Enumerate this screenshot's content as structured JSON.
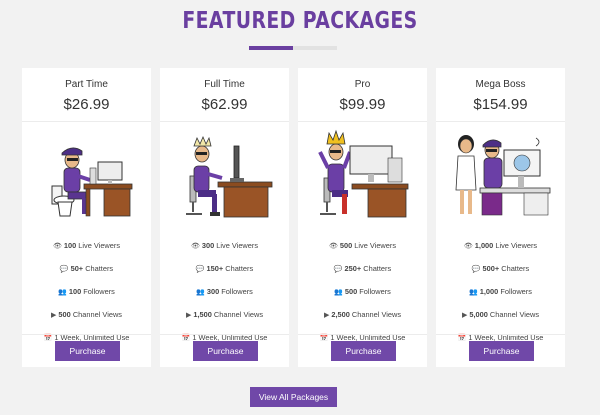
{
  "section": {
    "title": "FEATURED PACKAGES",
    "view_all_label": "View All Packages"
  },
  "colors": {
    "accent": "#6a3fa0",
    "button": "#7048a8",
    "background": "#f2f2f2",
    "card": "#ffffff"
  },
  "packages": [
    {
      "name": "Part Time",
      "price": "$26.99",
      "image": "bitmoji-on-toilet-at-desk",
      "features": [
        {
          "icon": "eye-icon",
          "glyph": "👁",
          "value": "100",
          "label": "Live Viewers"
        },
        {
          "icon": "comments-icon",
          "glyph": "💬",
          "value": "50+",
          "label": "Chatters"
        },
        {
          "icon": "users-icon",
          "glyph": "👥",
          "value": "100",
          "label": "Followers"
        },
        {
          "icon": "play-icon",
          "glyph": "▶",
          "value": "500",
          "label": "Channel Views"
        },
        {
          "icon": "calendar-icon",
          "glyph": "📅",
          "value": "",
          "label": "1 Week, Unlimited Use"
        }
      ],
      "button_label": "Purchase"
    },
    {
      "name": "Full Time",
      "price": "$62.99",
      "image": "bitmoji-with-crown-at-desk",
      "features": [
        {
          "icon": "eye-icon",
          "glyph": "👁",
          "value": "300",
          "label": "Live Viewers"
        },
        {
          "icon": "comments-icon",
          "glyph": "💬",
          "value": "150+",
          "label": "Chatters"
        },
        {
          "icon": "users-icon",
          "glyph": "👥",
          "value": "300",
          "label": "Followers"
        },
        {
          "icon": "play-icon",
          "glyph": "▶",
          "value": "1,500",
          "label": "Channel Views"
        },
        {
          "icon": "calendar-icon",
          "glyph": "📅",
          "value": "",
          "label": "1 Week, Unlimited Use"
        }
      ],
      "button_label": "Purchase"
    },
    {
      "name": "Pro",
      "price": "$99.99",
      "image": "bitmoji-king-at-desk",
      "features": [
        {
          "icon": "eye-icon",
          "glyph": "👁",
          "value": "500",
          "label": "Live Viewers"
        },
        {
          "icon": "comments-icon",
          "glyph": "💬",
          "value": "250+",
          "label": "Chatters"
        },
        {
          "icon": "users-icon",
          "glyph": "👥",
          "value": "500",
          "label": "Followers"
        },
        {
          "icon": "play-icon",
          "glyph": "▶",
          "value": "2,500",
          "label": "Channel Views"
        },
        {
          "icon": "calendar-icon",
          "glyph": "📅",
          "value": "",
          "label": "1 Week, Unlimited Use"
        }
      ],
      "button_label": "Purchase"
    },
    {
      "name": "Mega Boss",
      "price": "$154.99",
      "image": "bitmoji-boss-with-assistant",
      "features": [
        {
          "icon": "eye-icon",
          "glyph": "👁",
          "value": "1,000",
          "label": "Live Viewers"
        },
        {
          "icon": "comments-icon",
          "glyph": "💬",
          "value": "500+",
          "label": "Chatters"
        },
        {
          "icon": "users-icon",
          "glyph": "👥",
          "value": "1,000",
          "label": "Followers"
        },
        {
          "icon": "play-icon",
          "glyph": "▶",
          "value": "5,000",
          "label": "Channel Views"
        },
        {
          "icon": "calendar-icon",
          "glyph": "📅",
          "value": "",
          "label": "1 Week, Unlimited Use"
        }
      ],
      "button_label": "Purchase"
    }
  ]
}
